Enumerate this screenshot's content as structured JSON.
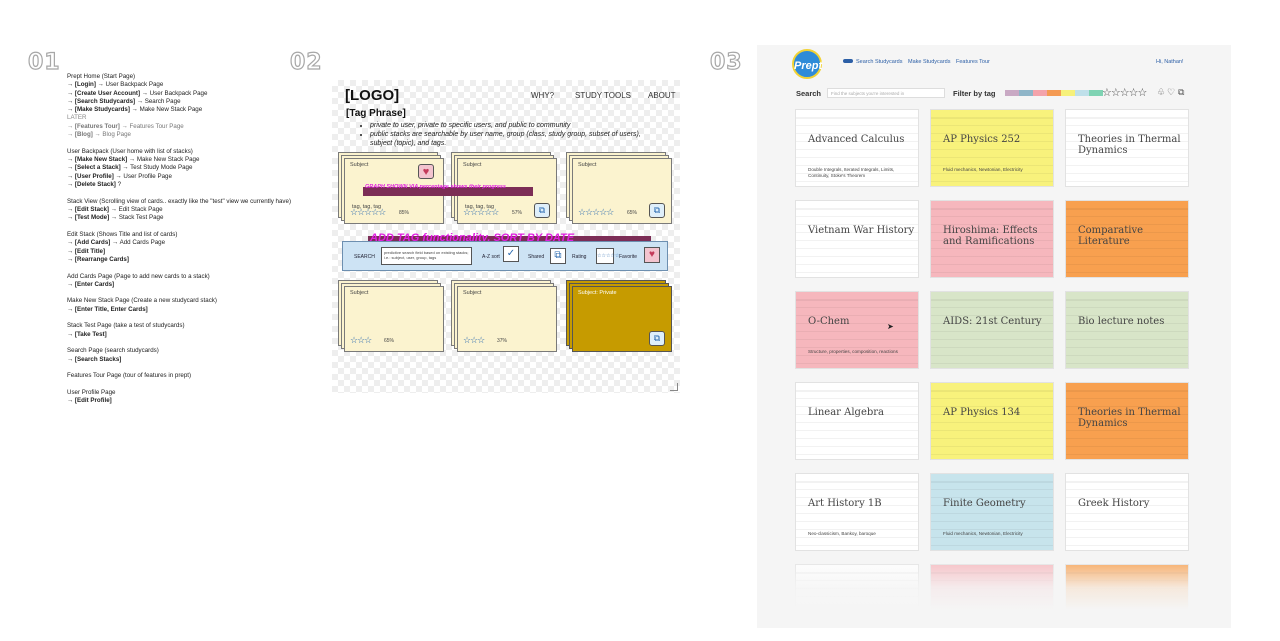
{
  "steps": [
    "01",
    "02",
    "03"
  ],
  "sitemap": [
    {
      "rows": [
        {
          "plain": "Prept Home (Start Page)"
        },
        {
          "prefix": "→ ",
          "bold": "[Login]",
          "rest": " → User Backpack Page"
        },
        {
          "prefix": "→ ",
          "bold": "[Create User Account]",
          "rest": " → User Backpack Page"
        },
        {
          "prefix": "→ ",
          "bold": "[Search Studycards]",
          "rest": " → Search Page"
        },
        {
          "prefix": "→ ",
          "bold": "[Make Studycards]",
          "rest": " → Make New Stack Page"
        },
        {
          "plain": "LATER",
          "cls": "later"
        },
        {
          "prefix": "→ ",
          "bold": "[Features Tour]",
          "rest": " → Features Tour Page",
          "cls": "dim"
        },
        {
          "prefix": "→ ",
          "bold": "[Blog]",
          "rest": " → Blog Page",
          "cls": "dim"
        }
      ]
    },
    {
      "rows": [
        {
          "plain": "User Backpack (User home with list of stacks)"
        },
        {
          "prefix": "→ ",
          "bold": "[Make New Stack]",
          "rest": " → Make New Stack Page"
        },
        {
          "prefix": "→ ",
          "bold": "[Select a Stack]",
          "rest": " → Test Study Mode Page"
        },
        {
          "prefix": "→ ",
          "bold": "[User Profile]",
          "rest": " → User Profile Page"
        },
        {
          "prefix": "→ ",
          "bold": "[Delete Stack]",
          "rest": " ?"
        }
      ]
    },
    {
      "rows": [
        {
          "plain": "Stack View (Scrolling view of cards.. exactly like the \"test\" view we currently have)"
        },
        {
          "prefix": "→ ",
          "bold": "[Edit Stack]",
          "rest": " → Edit Stack Page"
        },
        {
          "prefix": "→ ",
          "bold": "[Test Mode]",
          "rest": " → Stack Test Page"
        }
      ]
    },
    {
      "rows": [
        {
          "plain": "Edit Stack (Shows Title and list of cards)"
        },
        {
          "prefix": "→ ",
          "bold": "[Add Cards]",
          "rest": " → Add Cards Page"
        },
        {
          "prefix": "→ ",
          "bold": "[Edit Title]",
          "rest": ""
        },
        {
          "prefix": "→ ",
          "bold": "[Rearrange Cards]",
          "rest": ""
        }
      ]
    },
    {
      "rows": [
        {
          "plain": "Add Cards Page (Page to add new cards to a stack)"
        },
        {
          "prefix": "→ ",
          "bold": "[Enter Cards]",
          "rest": ""
        }
      ]
    },
    {
      "rows": [
        {
          "plain": "Make New Stack Page (Create a new studycard stack)"
        },
        {
          "prefix": "→ ",
          "bold": "[Enter Title, Enter Cards]",
          "rest": ""
        }
      ]
    },
    {
      "rows": [
        {
          "plain": "Stack Test Page (take a test of studycards)"
        },
        {
          "prefix": "→ ",
          "bold": "[Take Test]",
          "rest": ""
        }
      ]
    },
    {
      "rows": [
        {
          "plain": "Search Page (search studycards)"
        },
        {
          "prefix": "→ ",
          "bold": "[Search Stacks]",
          "rest": ""
        }
      ]
    },
    {
      "rows": [
        {
          "plain": "Features Tour Page (tour of features in prept)"
        }
      ]
    },
    {
      "rows": [
        {
          "plain": "User Profile Page"
        },
        {
          "prefix": "→ ",
          "bold": "[Edit Profile]",
          "rest": ""
        }
      ]
    }
  ],
  "wireframe": {
    "logo": "[LOGO]",
    "nav": [
      "WHY?",
      "STUDY TOOLS",
      "ABOUT"
    ],
    "tag_phrase": "[Tag Phrase]",
    "bullets": [
      "private to user, private to specific users, and public to community",
      "public stacks are searchable by user name, group (class, study group, subset of users), subject (topic), and tags."
    ],
    "subject_label": "Subject",
    "subject_private_label": "Subject: Private",
    "tags": "tag, tag, tag",
    "stars": "☆☆☆☆☆",
    "stars_short": "☆☆☆",
    "pcts": [
      "85%",
      "57%",
      "65%",
      "65%",
      "37%"
    ],
    "annotation_1": "GRAPH SHOWN VIA percentage shows their progress",
    "annotation_2": "ADD TAG functionality, SORT BY DATE",
    "search_bar": {
      "label": "SEARCH",
      "input_text": "predictive search field based on existing stacks; i.e.: subject, user, group, tags",
      "az": "A-Z sort",
      "shared": "Shared",
      "rating": "Rating",
      "rating_stars": "☆☆☆☆☆",
      "favorite": "Favorite"
    }
  },
  "app": {
    "logo": "Prept",
    "nav": [
      "Search Studycards",
      "Make Studycards",
      "Features Tour"
    ],
    "greeting": "Hi, Nathan!",
    "search_label": "Search",
    "search_placeholder": "Find the subjects you're interested in",
    "filter_label": "Filter by tag",
    "tag_colors": [
      "#c9a9c4",
      "#8fb5c8",
      "#f3a3ab",
      "#f49a53",
      "#f6f17b",
      "#bfe0ea",
      "#7fd3b3"
    ],
    "rating_stars": "☆☆☆☆☆",
    "cards": [
      {
        "title": "Advanced Calculus",
        "sub": "Double Integrals, Iterated Integrals, Limits, Continuity, Stoke's Theorem",
        "color": "#ffffff"
      },
      {
        "title": "AP Physics 252",
        "sub": "Fluid mechanics, Newtonian, Electricity",
        "color": "#f8f27c"
      },
      {
        "title": "Theories in Thermal Dynamics",
        "sub": "",
        "color": "#ffffff"
      },
      {
        "title": "Vietnam War History",
        "sub": "",
        "color": "#ffffff"
      },
      {
        "title": "Hiroshima: Effects and Ramifications",
        "sub": "",
        "color": "#f6b7bd"
      },
      {
        "title": "Comparative Literature",
        "sub": "",
        "color": "#f8a04f"
      },
      {
        "title": "O-Chem",
        "sub": "Structure, properties, composition, reactions",
        "color": "#f6b7bd"
      },
      {
        "title": "AIDS: 21st Century",
        "sub": "",
        "color": "#d8e5c8"
      },
      {
        "title": "Bio lecture notes",
        "sub": "",
        "color": "#d8e5c8"
      },
      {
        "title": "Linear Algebra",
        "sub": "",
        "color": "#ffffff"
      },
      {
        "title": "AP Physics 134",
        "sub": "",
        "color": "#f8f27c"
      },
      {
        "title": "Theories in Thermal Dynamics",
        "sub": "",
        "color": "#f8a04f"
      },
      {
        "title": "Art History 1B",
        "sub": "Neo-classicism, Bankoy, baroque",
        "color": "#ffffff"
      },
      {
        "title": "Finite Geometry",
        "sub": "Fluid mechanics, Newtonian, Electricity",
        "color": "#c7e4ec"
      },
      {
        "title": "Greek History",
        "sub": "",
        "color": "#ffffff"
      },
      {
        "title": "",
        "sub": "",
        "color": "#ffffff"
      },
      {
        "title": "",
        "sub": "",
        "color": "#f6b7bd"
      },
      {
        "title": "",
        "sub": "",
        "color": "#f8a04f"
      }
    ]
  }
}
